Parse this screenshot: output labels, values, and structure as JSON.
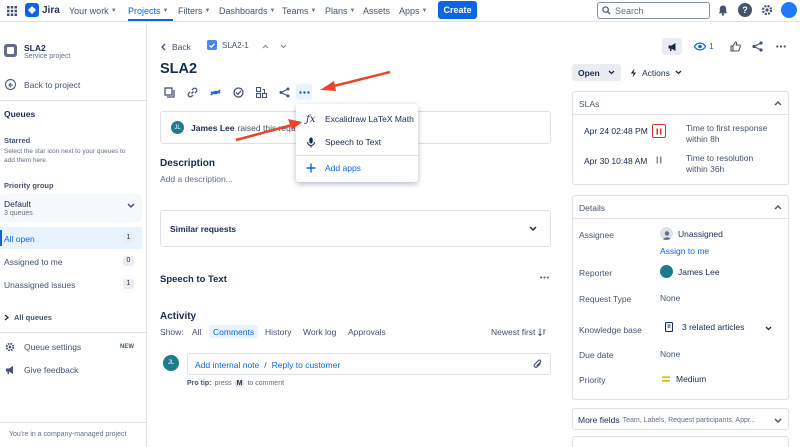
{
  "topnav": {
    "brand": "Jira",
    "items": [
      {
        "label": "Your work",
        "active": false
      },
      {
        "label": "Projects",
        "active": true
      },
      {
        "label": "Filters",
        "active": false
      },
      {
        "label": "Dashboards",
        "active": false
      },
      {
        "label": "Teams",
        "active": false
      },
      {
        "label": "Plans",
        "active": false
      },
      {
        "label": "Assets",
        "active": false
      },
      {
        "label": "Apps",
        "active": false
      }
    ],
    "create_label": "Create",
    "search_placeholder": "Search"
  },
  "sidebar": {
    "project_name": "SLA2",
    "project_type": "Service project",
    "back_label": "Back to project",
    "queues_heading": "Queues",
    "starred_heading": "Starred",
    "starred_hint_1": "Select the star icon next to your queues to",
    "starred_hint_2": "add them here.",
    "priority_group_heading": "Priority group",
    "group_name": "Default",
    "group_count": "3 queues",
    "queues": [
      {
        "label": "All open",
        "count": "1",
        "selected": true
      },
      {
        "label": "Assigned to me",
        "count": "0",
        "selected": false
      },
      {
        "label": "Unassigned issues",
        "count": "1",
        "selected": false
      }
    ],
    "all_queues_label": "All queues",
    "queue_settings_label": "Queue settings",
    "new_badge": "NEW",
    "give_feedback_label": "Give feedback",
    "footer_text": "You're in a company-managed project"
  },
  "issue": {
    "back_label": "Back",
    "key": "SLA2-1",
    "title": "SLA2",
    "raised_by_name": "James Lee",
    "raised_text": "raised this reque",
    "reporter_initials": "JL",
    "description_heading": "Description",
    "description_placeholder": "Add a description...",
    "similar_requests_label": "Similar requests",
    "speech_section_heading": "Speech to Text",
    "activity_heading": "Activity",
    "show_label": "Show:",
    "activity_tabs": [
      {
        "label": "All",
        "active": false
      },
      {
        "label": "Comments",
        "active": true
      },
      {
        "label": "History",
        "active": false
      },
      {
        "label": "Work log",
        "active": false
      },
      {
        "label": "Approvals",
        "active": false
      }
    ],
    "sort_label": "Newest first",
    "commenter_initials": "JL",
    "add_internal_note": "Add internal note",
    "separator": "/",
    "reply_to_customer": "Reply to customer",
    "pro_tip_bold": "Pro tip:",
    "pro_tip_text_1": "press",
    "pro_tip_key": "M",
    "pro_tip_text_2": "to comment"
  },
  "apps_menu": {
    "items": [
      {
        "label": "Excalidraw LaTeX Math",
        "icon": "fx-icon"
      },
      {
        "label": "Speech to Text",
        "icon": "microphone-icon"
      },
      {
        "label": "Add apps",
        "icon": "plus-icon"
      }
    ]
  },
  "right_panel": {
    "watch_count": "1",
    "status_label": "Open",
    "actions_label": "Actions",
    "slas_heading": "SLAs",
    "slas": [
      {
        "date": "Apr 24 02:48 PM",
        "goal_1": "Time to first response",
        "goal_2": "within 8h",
        "state": "paused-breached"
      },
      {
        "date": "Apr 30 10:48 AM",
        "goal_1": "Time to resolution",
        "goal_2": "within 36h",
        "state": "paused"
      }
    ],
    "details_heading": "Details",
    "fields": {
      "assignee_label": "Assignee",
      "assignee_value": "Unassigned",
      "assign_to_me": "Assign to me",
      "reporter_label": "Reporter",
      "reporter_value": "James Lee",
      "request_type_label": "Request Type",
      "request_type_value": "None",
      "knowledge_base_label": "Knowledge base",
      "knowledge_base_value": "3 related articles",
      "due_date_label": "Due date",
      "due_date_value": "None",
      "priority_label": "Priority",
      "priority_value": "Medium"
    },
    "more_fields_label": "More fields",
    "more_fields_hint": "Team, Labels, Request participants, Appr..."
  },
  "colors": {
    "accent": "#0c66e4",
    "annotation_arrow": "#e8452c",
    "breach_red": "#c9372c",
    "priority_medium": "#e2b203"
  }
}
